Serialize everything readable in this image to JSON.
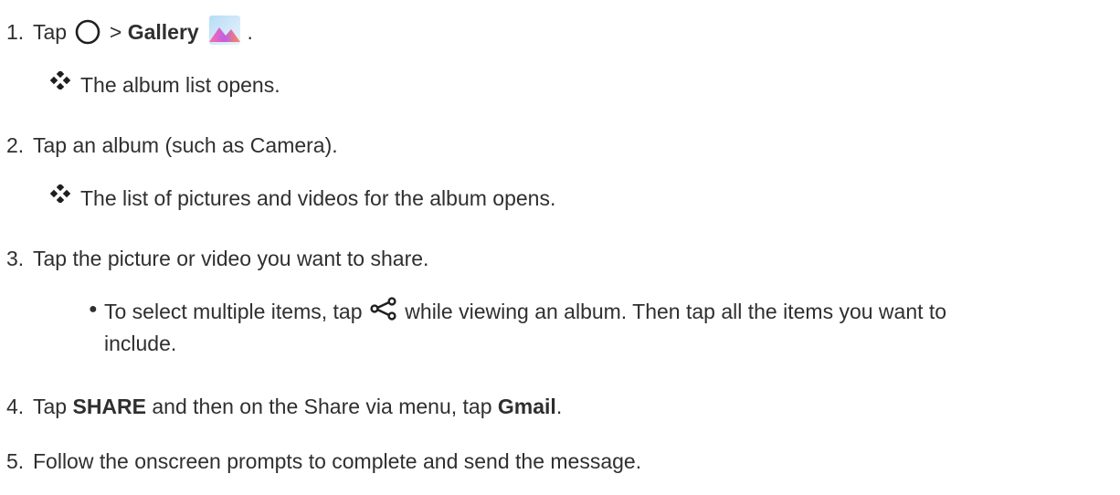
{
  "steps": [
    {
      "number": "1.",
      "tap": "Tap",
      "sep": ">",
      "bold": "Gallery",
      "end": ".",
      "icons": [
        "home-circle-icon",
        "gallery-app-icon"
      ],
      "result": "The album list opens."
    },
    {
      "number": "2.",
      "text": "Tap an album (such as Camera).",
      "result": "The list of pictures and videos for the album opens."
    },
    {
      "number": "3.",
      "text": "Tap the picture or video you want to share.",
      "bullet": {
        "before": "To select multiple items, tap",
        "icon": "share-icon",
        "after": "while viewing an album. Then tap all the items you want to",
        "line2": "include."
      }
    },
    {
      "number": "4.",
      "pre": "Tap",
      "bold1": "SHARE",
      "mid": "and then on the Share via menu, tap",
      "bold2": "Gmail",
      "end": "."
    },
    {
      "number": "5.",
      "text": "Follow the onscreen prompts to complete and send the message."
    }
  ],
  "colors": {
    "text": "#2f2f2f",
    "diamond": "#1f1f1f"
  }
}
